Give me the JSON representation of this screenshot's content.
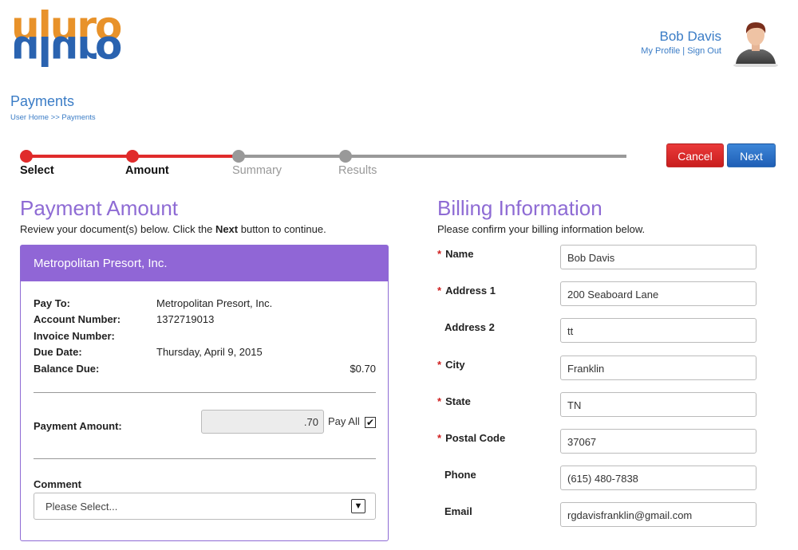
{
  "brand": {
    "logo_text": "uluro",
    "top_color": "#e8922a",
    "bottom_color": "#2a63b0"
  },
  "user": {
    "name": "Bob Davis",
    "profile_link": "My Profile",
    "separator": " | ",
    "signout_link": "Sign Out"
  },
  "page": {
    "title": "Payments",
    "breadcrumb": "User Home >> Payments"
  },
  "stepper": {
    "steps": [
      {
        "label": "Select",
        "state": "done"
      },
      {
        "label": "Amount",
        "state": "done"
      },
      {
        "label": "Summary",
        "state": "todo"
      },
      {
        "label": "Results",
        "state": "todo"
      }
    ],
    "done_color": "#e02b2b",
    "todo_color": "#999999"
  },
  "actions": {
    "cancel": "Cancel",
    "next": "Next"
  },
  "payment": {
    "title": "Payment Amount",
    "instruction_pre": "Review your document(s) below. Click the ",
    "instruction_bold": "Next",
    "instruction_post": " button to continue.",
    "card": {
      "header": "Metropolitan Presort, Inc.",
      "pay_to_label": "Pay To:",
      "pay_to_value": "Metropolitan Presort, Inc.",
      "account_label": "Account Number:",
      "account_value": "1372719013",
      "invoice_label": "Invoice Number:",
      "invoice_value": "",
      "due_label": "Due Date:",
      "due_value": "Thursday, April 9, 2015",
      "balance_label": "Balance Due:",
      "balance_value": "$0.70",
      "amount_label": "Payment Amount:",
      "amount_value": ".70",
      "pay_all_label": "Pay All",
      "pay_all_checked": true,
      "comment_label": "Comment",
      "comment_selected": "Please Select..."
    }
  },
  "billing": {
    "title": "Billing Information",
    "instruction": "Please confirm your billing information below.",
    "fields": [
      {
        "label": "Name",
        "required": true,
        "value": "Bob Davis"
      },
      {
        "label": "Address 1",
        "required": true,
        "value": "200 Seaboard Lane"
      },
      {
        "label": "Address 2",
        "required": false,
        "value": "tt"
      },
      {
        "label": "City",
        "required": true,
        "value": "Franklin"
      },
      {
        "label": "State",
        "required": true,
        "value": "TN"
      },
      {
        "label": "Postal Code",
        "required": true,
        "value": "37067"
      },
      {
        "label": "Phone",
        "required": false,
        "value": "(615) 480-7838"
      },
      {
        "label": "Email",
        "required": false,
        "value": "rgdavisfranklin@gmail.com"
      }
    ]
  },
  "colors": {
    "accent": "#8e6bd4",
    "link": "#3a7cc6",
    "card_header": "#9066d6"
  }
}
